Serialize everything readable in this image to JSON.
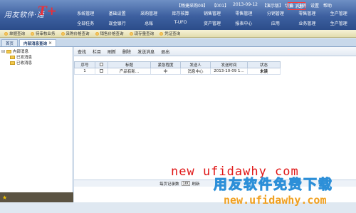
{
  "header": {
    "logo_text": "用友软件·通",
    "logo_mark": "T+",
    "status": {
      "account": "【畅捷采购09】",
      "user": "【001】",
      "date": "2013-09-12",
      "demo": "【演示版】",
      "message": "消息"
    },
    "toplinks": [
      "切换",
      "注销",
      "设置",
      "帮助"
    ],
    "menu": [
      "系统管理",
      "基础设置",
      "采购管理",
      "库存核算",
      "销售管理",
      "零售管理",
      "分销管理",
      "零售管理",
      "生产管理",
      "全部任务",
      "现金银行",
      "总账",
      "T-UFO",
      "资产管理",
      "报表中心",
      "应用",
      "业务管理",
      "生产管理"
    ]
  },
  "shortcuts": [
    "单据查询",
    "待审核业务",
    "采购价格查询",
    "销售价格查询",
    "现存量查询",
    "凭证查询"
  ],
  "tabs": [
    {
      "label": "首页",
      "active": false
    },
    {
      "label": "内部消息查询",
      "active": true
    }
  ],
  "tree": {
    "root": "内部消息",
    "children": [
      "已发消息",
      "已收消息"
    ]
  },
  "toolbar": [
    "查找",
    "栏目",
    "刷新",
    "删除",
    "发送消息",
    "退出"
  ],
  "table": {
    "headers": [
      "序号",
      "",
      "标题",
      "紧急程度",
      "发送人",
      "发送时间",
      "状态"
    ],
    "rows": [
      {
        "index": "1",
        "title": "产品有新...",
        "urgency": "中",
        "sender": "消息中心",
        "time": "2013-10-09 1...",
        "status": "未读"
      }
    ]
  },
  "pager": {
    "label": "每页记录数",
    "value": "100",
    "refresh": "刷新"
  },
  "watermarks": {
    "line1": "new ufidawhy com",
    "line2": "用友软件免费下载",
    "line3": "new.ufidawhy.com"
  }
}
